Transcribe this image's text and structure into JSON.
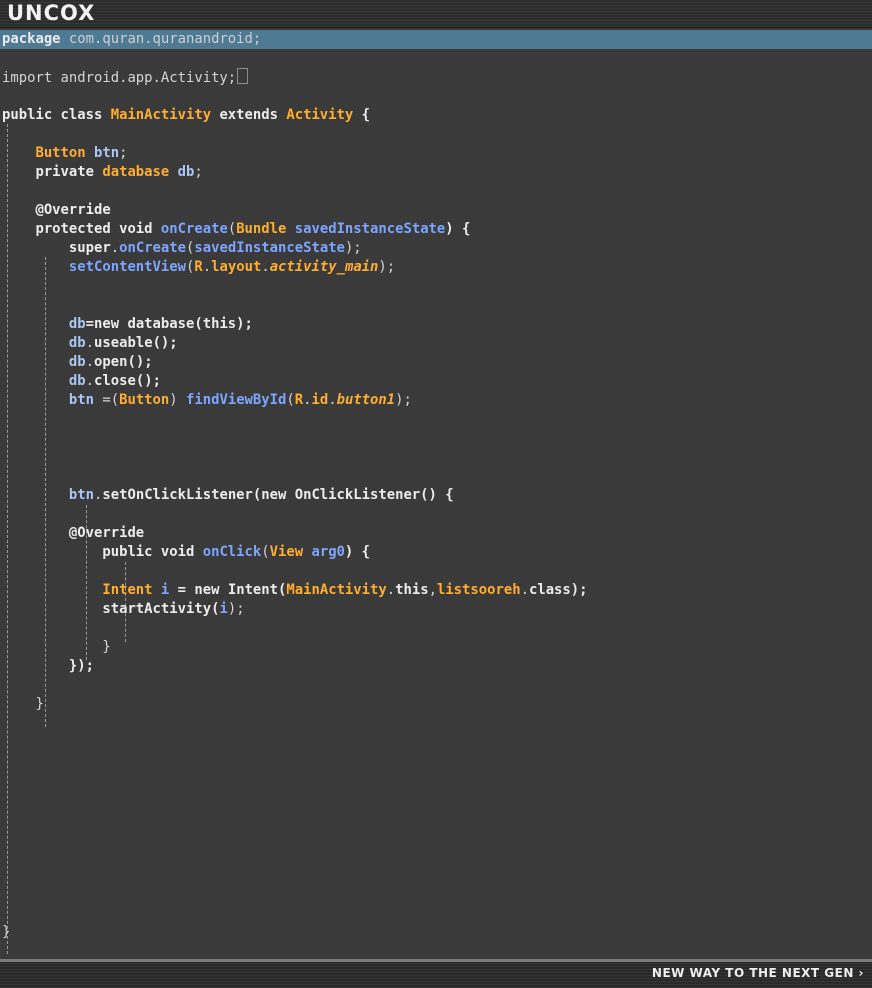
{
  "app": {
    "logo_text": "UNCOX",
    "tagline": "NEW WAY TO THE NEXT GEN ›"
  },
  "code": {
    "pkg_kw": "package",
    "pkg_name": " com.quran.quranandroid;",
    "import_line": "import android.app.Activity;",
    "cls_public": "public class ",
    "cls_name": "MainActivity",
    "cls_extends": " extends ",
    "cls_base": "Activity",
    "cls_open": " {",
    "btn_type": "Button",
    "btn_var": "btn",
    "semi": ";",
    "db_private": "private ",
    "db_type": "database",
    "db_var": "db",
    "override": "@Override",
    "oc_decl": "protected void ",
    "oc_name": "onCreate",
    "paren_open": "(",
    "bundle_type": "Bundle",
    "saved_param": "savedInstanceState",
    "close_brace_open": ") {",
    "super_kw": "super",
    "dot": ".",
    "super_call_end": ");",
    "scv": "setContentView",
    "r": "R",
    "layout": "layout",
    "activity_main": "activity_main",
    "new_db_rest": "=new database(this);",
    "useable": "useable",
    "call_end": "();",
    "open": "open",
    "close": "close",
    "btn_assign": " =(",
    "cast_close": ") ",
    "fvbi": "findViewById",
    "id": "id",
    "button1": "button1",
    "set_listener": "setOnClickListener(new OnClickListener() {",
    "click_decl": "public void ",
    "onclick": "onClick",
    "view_type": "View",
    "arg0": "arg0",
    "intent_type": "Intent",
    "i_var": "i",
    "intent_new": " = new Intent(",
    "this_kw": "this",
    "comma": ",",
    "listsooreh": "listsooreh",
    "class_end": "class);",
    "start_activity": "startActivity(",
    "brace_close": "}",
    "listener_close": "});"
  }
}
